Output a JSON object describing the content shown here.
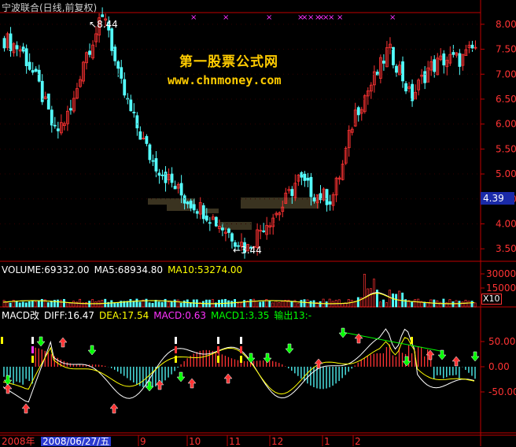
{
  "title": "宁波联合(日线,前复权)",
  "watermark": {
    "line1": "第一股票公式网",
    "line2": "www.chnmoney.com"
  },
  "price_panel": {
    "axis_ticks": [
      "8.00",
      "7.50",
      "7.00",
      "6.50",
      "6.00",
      "5.50",
      "5.00",
      "4.50",
      "4.00",
      "3.50"
    ],
    "high_marker": "8.44",
    "low_marker": "3.44",
    "current_price": "4.39"
  },
  "volume_panel": {
    "legend": [
      {
        "text": "VOLUME:69332.00",
        "color": "#ffffff"
      },
      {
        "text": "MA5:68934.80",
        "color": "#ffffff"
      },
      {
        "text": "MA10:53274.00",
        "color": "#ffff00"
      }
    ],
    "axis_ticks": [
      "30000",
      "15000"
    ],
    "unit_badge": "X10"
  },
  "macd_panel": {
    "legend": [
      {
        "text": "MACD改",
        "color": "#ffffff"
      },
      {
        "text": "DIFF:16.47",
        "color": "#ffffff"
      },
      {
        "text": "DEA:17.54",
        "color": "#ffff00"
      },
      {
        "text": "MACD:0.63",
        "color": "#ff33ff"
      },
      {
        "text": "MACD1:3.35",
        "color": "#00ff00"
      },
      {
        "text": "输出13:-",
        "color": "#00ff00"
      }
    ],
    "axis_ticks": [
      "50.00",
      "0.00",
      "-50.00"
    ]
  },
  "time_axis": {
    "year_label": "2008年",
    "cursor_date": "2008/06/27/五",
    "month_labels": [
      "9",
      "10",
      "11",
      "12",
      "1",
      "2"
    ]
  },
  "colors": {
    "up": "#ff3333",
    "down": "#54ffff",
    "grid": "#8b0000",
    "axis": "#c00000",
    "marker": "#ff33ff",
    "watermark": "#ffcc00"
  }
}
